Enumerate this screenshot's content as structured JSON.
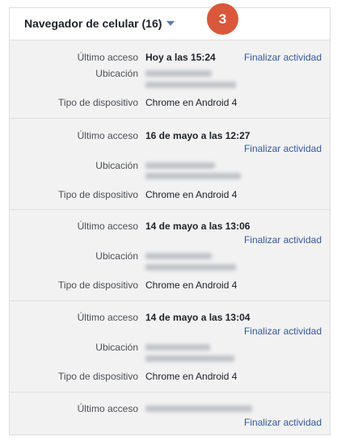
{
  "section": {
    "title": "Navegador de celular (16)",
    "badge": "3",
    "action_label": "Finalizar actividad",
    "labels": {
      "last_access": "Último acceso",
      "location": "Ubicación",
      "device_type": "Tipo de dispositivo"
    },
    "sessions": [
      {
        "last_access": "Hoy a las 15:24",
        "device": "Chrome en Android 4"
      },
      {
        "last_access": "16 de mayo a las 12:27",
        "device": "Chrome en Android 4"
      },
      {
        "last_access": "14 de mayo a las 13:06",
        "device": "Chrome en Android 4"
      },
      {
        "last_access": "14 de mayo a las 13:04",
        "device": "Chrome en Android 4"
      },
      {
        "last_access": "",
        "device": ""
      }
    ]
  },
  "colors": {
    "link": "#365899",
    "badge": "#d9583b",
    "panel_bg": "#f2f2f2"
  },
  "icons": {
    "caret": "caret-down-icon"
  }
}
